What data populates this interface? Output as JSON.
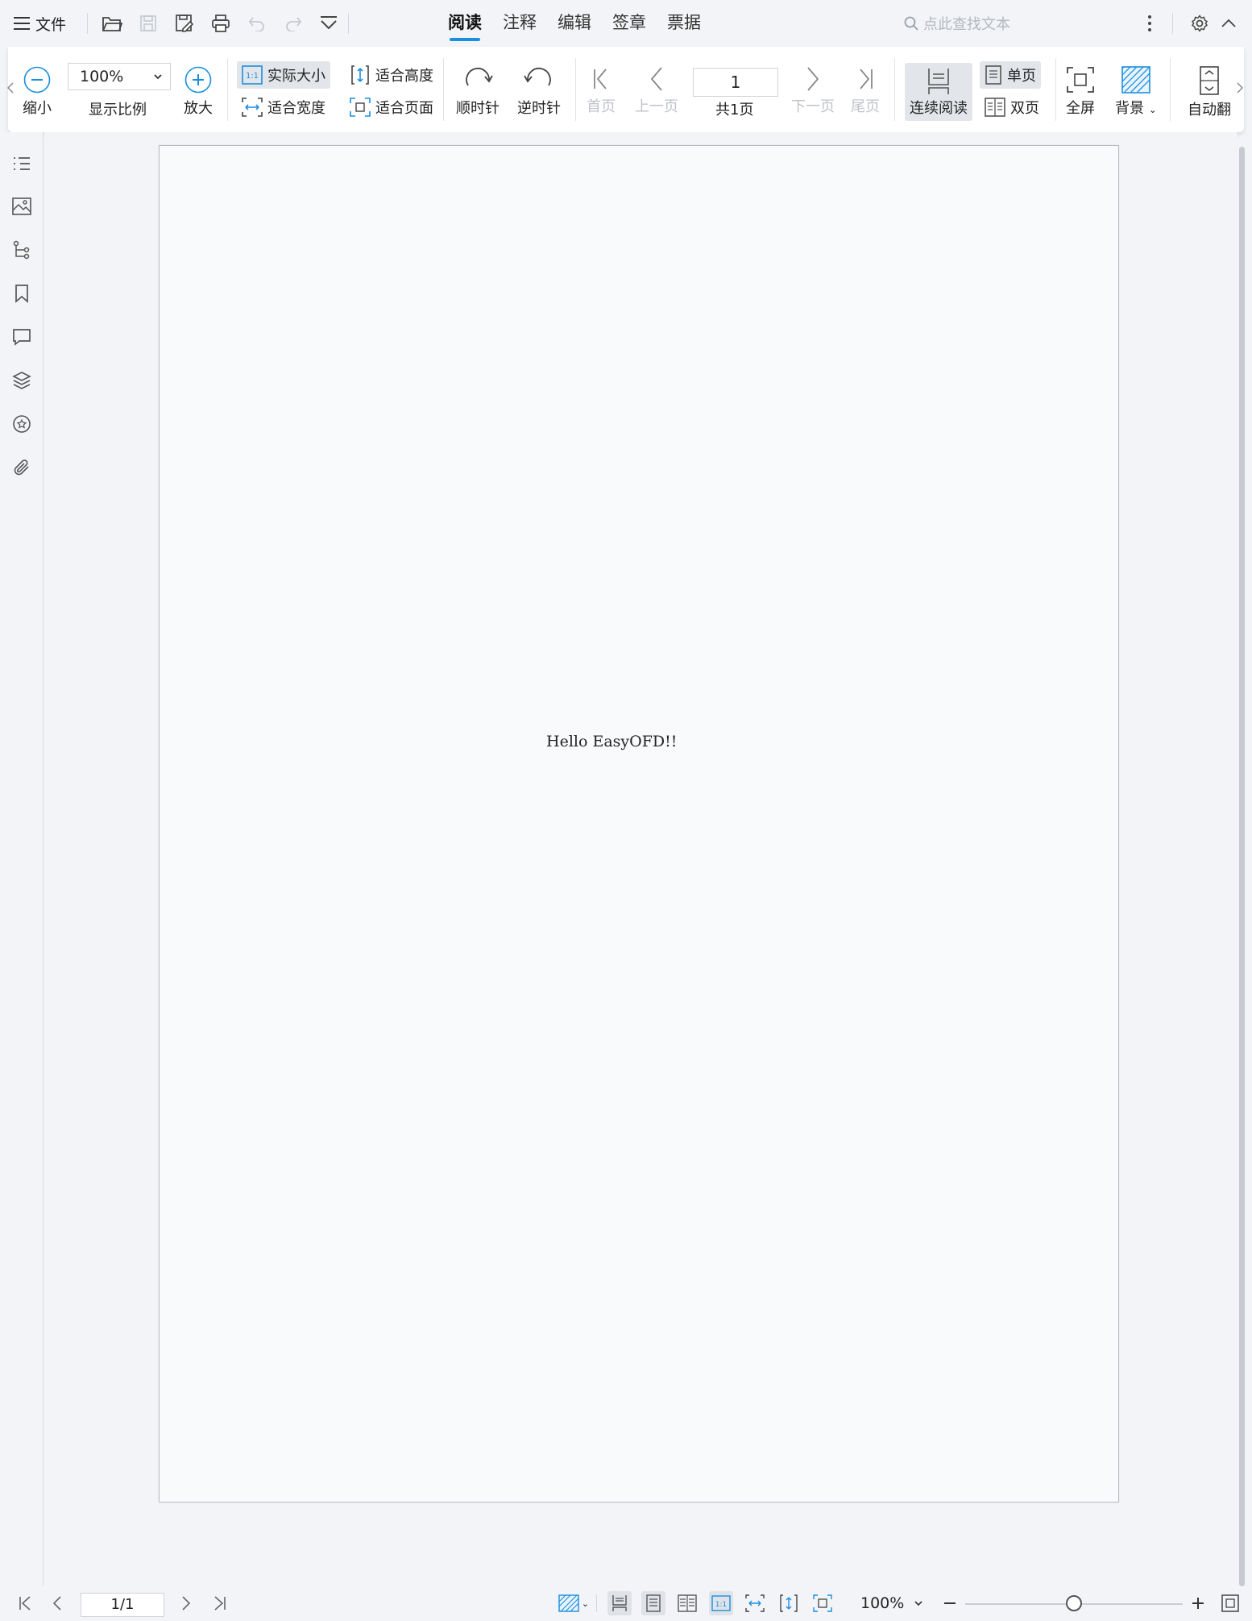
{
  "menu": {
    "file_label": "文件",
    "tabs": [
      {
        "label": "阅读",
        "active": true
      },
      {
        "label": "注释",
        "active": false
      },
      {
        "label": "编辑",
        "active": false
      },
      {
        "label": "签章",
        "active": false
      },
      {
        "label": "票据",
        "active": false
      }
    ],
    "search_placeholder": "点此查找文本"
  },
  "ribbon": {
    "zoom_out_label": "缩小",
    "zoom_value": "100%",
    "zoom_label": "显示比例",
    "zoom_in_label": "放大",
    "actual_size_label": "实际大小",
    "fit_width_label": "适合宽度",
    "fit_height_label": "适合高度",
    "fit_page_label": "适合页面",
    "rotate_cw_label": "顺时针",
    "rotate_ccw_label": "逆时针",
    "first_page_label": "首页",
    "prev_page_label": "上一页",
    "page_input_value": "1",
    "total_pages_label": "共1页",
    "next_page_label": "下一页",
    "last_page_label": "尾页",
    "continuous_label": "连续阅读",
    "single_page_label": "单页",
    "double_page_label": "双页",
    "fullscreen_label": "全屏",
    "background_label": "背景",
    "auto_flip_label": "自动翻"
  },
  "document": {
    "text": "Hello EasyOFD!!"
  },
  "statusbar": {
    "page_indicator": "1/1",
    "zoom_value": "100%",
    "zoom_slider_fraction": 0.5
  },
  "colors": {
    "accent": "#1a8fe0",
    "icon_blue": "#1a8fe0",
    "icon_gray": "#555555",
    "disabled": "#bfc3c9"
  }
}
